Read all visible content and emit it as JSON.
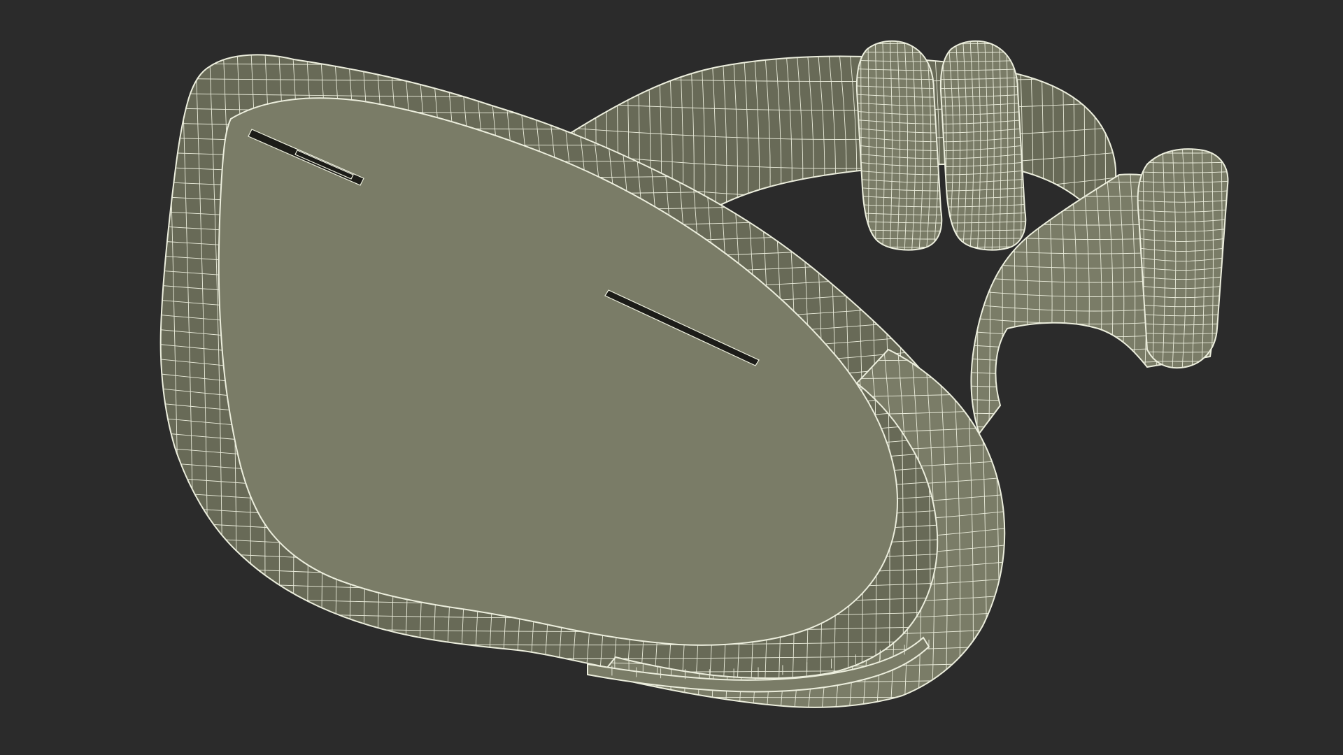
{
  "scene": {
    "subject": "ski-goggles-wireframe",
    "background_color": "#2b2b2b",
    "surface_color": "#7a7c67",
    "surface_dark_color": "#686a57",
    "wire_color": "#eceedd",
    "slot_color": "#1c1c18",
    "shading": "solid-with-wireframe"
  }
}
